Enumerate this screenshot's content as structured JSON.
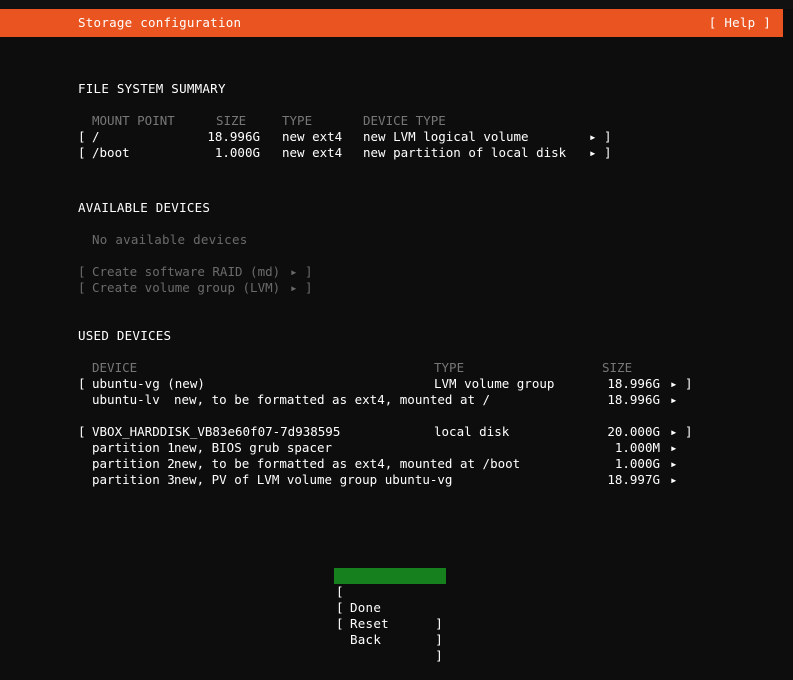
{
  "colors": {
    "background": "#0d0d0d",
    "header_bar": "#e95420",
    "selection_green": "#16801f",
    "text": "#ffffff",
    "muted_text": "#777777",
    "disabled_text": "#6b6b6b"
  },
  "header": {
    "title": "Storage configuration",
    "help_label": "[ Help ]"
  },
  "file_system_summary": {
    "section_title": "FILE SYSTEM SUMMARY",
    "columns": [
      "MOUNT POINT",
      "SIZE",
      "TYPE",
      "DEVICE TYPE"
    ],
    "rows": [
      {
        "bracket_open": "[",
        "mount_point": "/",
        "size": "18.996G",
        "type": "new ext4",
        "device_type": "new LVM logical volume",
        "arrow": "▸",
        "bracket_close": "]"
      },
      {
        "bracket_open": "[",
        "mount_point": "/boot",
        "size": "1.000G",
        "type": "new ext4",
        "device_type": "new partition of local disk",
        "arrow": "▸",
        "bracket_close": "]"
      }
    ]
  },
  "available_devices": {
    "section_title": "AVAILABLE DEVICES",
    "empty_message": "No available devices",
    "actions": [
      {
        "bracket_open": "[",
        "label": "Create software RAID (md)",
        "arrow": "▸",
        "bracket_close": "]",
        "disabled": true
      },
      {
        "bracket_open": "[",
        "label": "Create volume group (LVM)",
        "arrow": "▸",
        "bracket_close": "]",
        "disabled": true
      }
    ]
  },
  "used_devices": {
    "section_title": "USED DEVICES",
    "columns": [
      "DEVICE",
      "TYPE",
      "SIZE"
    ],
    "groups": [
      {
        "device": {
          "bracket_open": "[",
          "name": "ubuntu-vg (new)",
          "type": "LVM volume group",
          "size": "18.996G",
          "arrow": "▸",
          "bracket_close": "]"
        },
        "children": [
          {
            "name": "ubuntu-lv",
            "description": "new, to be formatted as ext4, mounted at /",
            "size": "18.996G",
            "arrow": "▸"
          }
        ]
      },
      {
        "device": {
          "bracket_open": "[",
          "name": "VBOX_HARDDISK_VB83e60f07-7d938595",
          "type": "local disk",
          "size": "20.000G",
          "arrow": "▸",
          "bracket_close": "]"
        },
        "children": [
          {
            "name": "partition 1",
            "description": "new, BIOS grub spacer",
            "size": "1.000M",
            "arrow": "▸"
          },
          {
            "name": "partition 2",
            "description": "new, to be formatted as ext4, mounted at /boot",
            "size": "1.000G",
            "arrow": "▸"
          },
          {
            "name": "partition 3",
            "description": "new, PV of LVM volume group ubuntu-vg",
            "size": "18.997G",
            "arrow": "▸"
          }
        ]
      }
    ]
  },
  "buttons": [
    {
      "bracket_open": "[",
      "label": "Done",
      "bracket_close": "]",
      "selected": true
    },
    {
      "bracket_open": "[",
      "label": "Reset",
      "bracket_close": "]",
      "selected": false
    },
    {
      "bracket_open": "[",
      "label": "Back",
      "bracket_close": "]",
      "selected": false
    }
  ]
}
